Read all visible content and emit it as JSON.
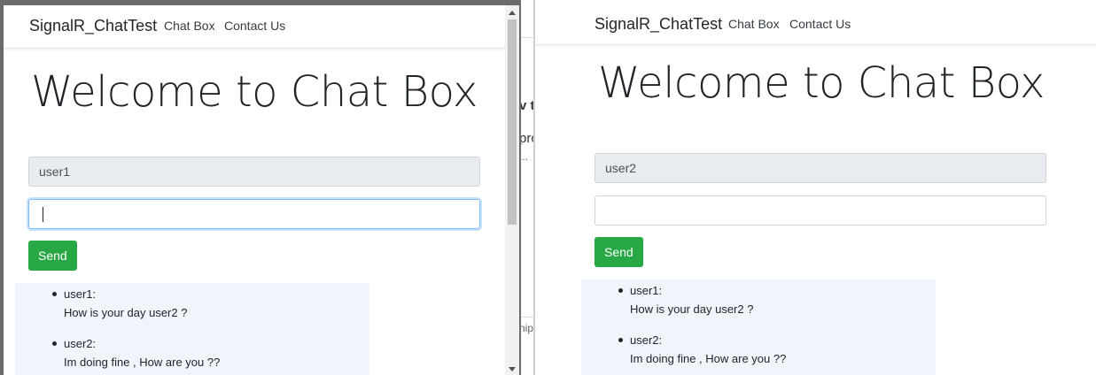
{
  "left_window": {
    "navbar": {
      "brand": "SignalR_ChatTest",
      "links": [
        "Chat Box",
        "Contact Us"
      ]
    },
    "heading": "Welcome to Chat Box",
    "user_field": {
      "value": "user1"
    },
    "message_field": {
      "value": ""
    },
    "send_label": "Send",
    "messages": [
      {
        "user": "user1:",
        "text": "How is your day user2 ?"
      },
      {
        "user": "user2:",
        "text": "Im doing fine , How are you ??"
      }
    ]
  },
  "right_window": {
    "navbar": {
      "brand": "SignalR_ChatTest",
      "links": [
        "Chat Box",
        "Contact Us"
      ]
    },
    "heading": "Welcome to Chat Box",
    "user_field": {
      "value": "user2"
    },
    "message_field": {
      "value": ""
    },
    "send_label": "Send",
    "messages": [
      {
        "user": "user1:",
        "text": "How is your day user2 ?"
      },
      {
        "user": "user2:",
        "text": "Im doing fine , How are you ??"
      }
    ]
  },
  "background_fragments": [
    "v t",
    "pro",
    "...",
    "nip"
  ]
}
